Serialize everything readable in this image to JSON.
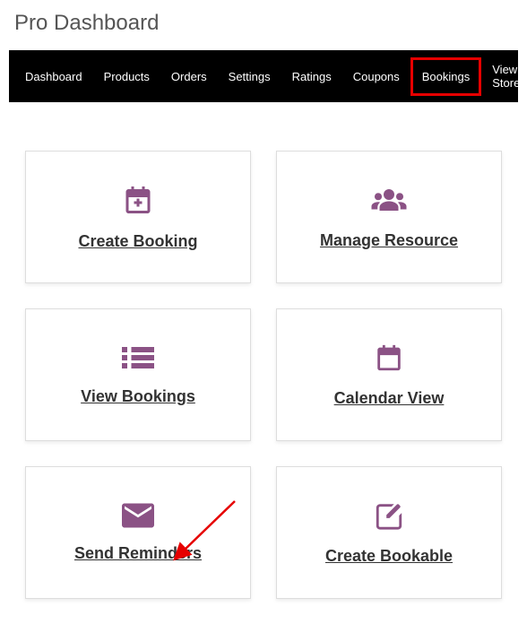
{
  "page_title": "Pro Dashboard",
  "nav": {
    "items": [
      {
        "label": "Dashboard"
      },
      {
        "label": "Products"
      },
      {
        "label": "Orders"
      },
      {
        "label": "Settings"
      },
      {
        "label": "Ratings"
      },
      {
        "label": "Coupons"
      },
      {
        "label": "Bookings"
      },
      {
        "label": "View Store"
      }
    ]
  },
  "cards": {
    "create_booking": {
      "label": "Create Booking"
    },
    "manage_resource": {
      "label": "Manage Resource"
    },
    "view_bookings": {
      "label": "View Bookings"
    },
    "calendar_view": {
      "label": "Calendar View"
    },
    "send_reminders": {
      "label": "Send Reminders"
    },
    "create_bookable": {
      "label": "Create Bookable"
    }
  },
  "colors": {
    "accent": "#8b5285",
    "highlight_border": "#e60000",
    "annotation_arrow": "#e60000"
  }
}
